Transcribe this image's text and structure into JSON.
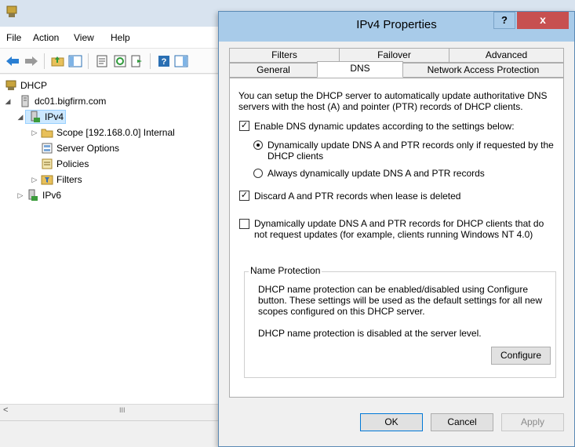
{
  "mmc": {
    "menu": [
      "File",
      "Action",
      "View",
      "Help"
    ],
    "toolbar_icons": [
      "back-arrow-icon",
      "forward-arrow-icon",
      "up-folder-icon",
      "show-hide-tree-icon",
      "properties-icon",
      "refresh-icon",
      "export-list-icon",
      "help-icon",
      "show-hide-action-pane-icon"
    ],
    "tree": {
      "root": "DHCP",
      "server": "dc01.bigfirm.com",
      "ipv4": "IPv4",
      "scope": "Scope [192.168.0.0] Internal",
      "server_options": "Server Options",
      "policies": "Policies",
      "filters": "Filters",
      "ipv6": "IPv6"
    },
    "scrollbar_thumb": "III"
  },
  "dialog": {
    "title": "IPv4 Properties",
    "help_label": "?",
    "close_label": "x",
    "tabs_row1": [
      "Filters",
      "Failover",
      "Advanced"
    ],
    "tabs_row2": [
      "General",
      "DNS",
      "Network Access Protection"
    ],
    "active_tab": "DNS",
    "intro": "You can setup the DHCP server to automatically update authoritative DNS servers with the host (A) and pointer (PTR) records of DHCP clients.",
    "enable_dns_updates": {
      "label": "Enable DNS dynamic updates according to the settings below:",
      "checked": true
    },
    "radio_on_request": {
      "label": "Dynamically update DNS A and PTR records only if requested by the DHCP clients",
      "selected": true
    },
    "radio_always": {
      "label": "Always dynamically update DNS A and PTR records",
      "selected": false
    },
    "discard_records": {
      "label": "Discard A and PTR records when lease is deleted",
      "checked": true
    },
    "update_non_requesting": {
      "label": "Dynamically update DNS A and PTR records for DHCP clients that do not request updates (for example, clients running Windows NT 4.0)",
      "checked": false
    },
    "name_protection": {
      "legend": "Name Protection",
      "description": "DHCP name protection can be enabled/disabled using Configure button. These settings will be used as the default settings for all new scopes configured on this DHCP server.",
      "status": "DHCP name protection is disabled at the server level.",
      "configure_label": "Configure"
    },
    "buttons": {
      "ok": "OK",
      "cancel": "Cancel",
      "apply": "Apply"
    },
    "colors": {
      "title_bar": "#a8cbe9",
      "close_button": "#c75050"
    }
  }
}
